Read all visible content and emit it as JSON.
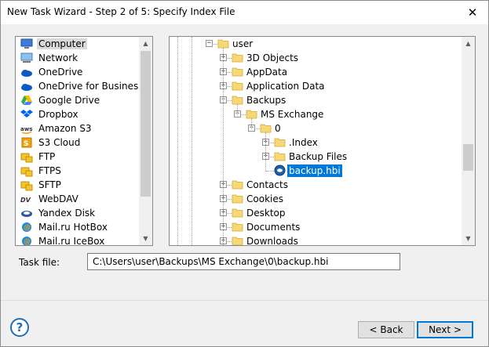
{
  "window": {
    "title": "New Task Wizard - Step 2 of 5: Specify Index File",
    "close_glyph": "✕"
  },
  "storage_list": [
    {
      "label": "Computer",
      "icon": "computer-icon",
      "selected": true
    },
    {
      "label": "Network",
      "icon": "network-icon"
    },
    {
      "label": "OneDrive",
      "icon": "onedrive-icon"
    },
    {
      "label": "OneDrive for Business",
      "icon": "onedrive-business-icon"
    },
    {
      "label": "Google Drive",
      "icon": "google-drive-icon"
    },
    {
      "label": "Dropbox",
      "icon": "dropbox-icon"
    },
    {
      "label": "Amazon S3",
      "icon": "amazon-s3-icon"
    },
    {
      "label": "S3 Cloud",
      "icon": "s3-cloud-icon"
    },
    {
      "label": "FTP",
      "icon": "ftp-icon"
    },
    {
      "label": "FTPS",
      "icon": "ftps-icon"
    },
    {
      "label": "SFTP",
      "icon": "sftp-icon"
    },
    {
      "label": "WebDAV",
      "icon": "webdav-icon"
    },
    {
      "label": "Yandex Disk",
      "icon": "yandex-disk-icon"
    },
    {
      "label": "Mail.ru HotBox",
      "icon": "mailru-hotbox-icon"
    },
    {
      "label": "Mail.ru IceBox",
      "icon": "mailru-icebox-icon"
    }
  ],
  "tree": [
    {
      "label": "user",
      "level": 0,
      "expander": "−",
      "type": "folder"
    },
    {
      "label": "3D Objects",
      "level": 1,
      "expander": "+",
      "type": "folder"
    },
    {
      "label": "AppData",
      "level": 1,
      "expander": "+",
      "type": "folder"
    },
    {
      "label": "Application Data",
      "level": 1,
      "expander": "+",
      "type": "folder"
    },
    {
      "label": "Backups",
      "level": 1,
      "expander": "−",
      "type": "folder"
    },
    {
      "label": "MS Exchange",
      "level": 2,
      "expander": "−",
      "type": "folder"
    },
    {
      "label": "0",
      "level": 3,
      "expander": "−",
      "type": "folder"
    },
    {
      "label": ".Index",
      "level": 4,
      "expander": "+",
      "type": "folder"
    },
    {
      "label": "Backup Files",
      "level": 4,
      "expander": "+",
      "type": "folder"
    },
    {
      "label": "backup.hbi",
      "level": 4,
      "expander": "",
      "type": "file",
      "selected": true
    },
    {
      "label": "Contacts",
      "level": 1,
      "expander": "+",
      "type": "folder"
    },
    {
      "label": "Cookies",
      "level": 1,
      "expander": "+",
      "type": "folder"
    },
    {
      "label": "Desktop",
      "level": 1,
      "expander": "+",
      "type": "folder"
    },
    {
      "label": "Documents",
      "level": 1,
      "expander": "+",
      "type": "folder"
    },
    {
      "label": "Downloads",
      "level": 1,
      "expander": "+",
      "type": "folder"
    }
  ],
  "task_file": {
    "label": "Task file:",
    "value": "C:\\Users\\user\\Backups\\MS Exchange\\0\\backup.hbi"
  },
  "buttons": {
    "help": "?",
    "back": "< Back",
    "next": "Next >"
  },
  "scroll": {
    "up": "▲",
    "down": "▼"
  },
  "colors": {
    "selection": "#0078d7",
    "folder": "#f8d775"
  }
}
